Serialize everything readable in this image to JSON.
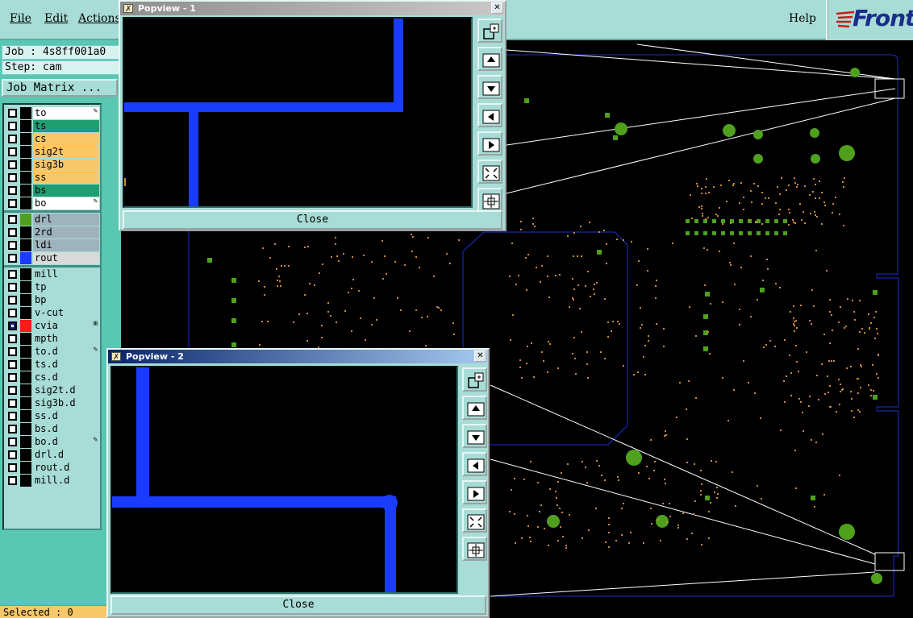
{
  "menubar": {
    "file": "File",
    "edit": "Edit",
    "actions": "Actions",
    "help": "Help",
    "logo": "Front"
  },
  "job": {
    "job_line": "Job : 4s8ff001a0",
    "step_line": "Step: cam",
    "matrix_button": "Job Matrix ..."
  },
  "layers": [
    {
      "name": "to",
      "bg": "#ffffff",
      "swatch": "#000000",
      "mark": "✎",
      "checked": false
    },
    {
      "name": "ts",
      "bg": "#1f9e72",
      "swatch": "#000000",
      "mark": "",
      "checked": false
    },
    {
      "name": "cs",
      "bg": "#f7c86a",
      "swatch": "#000000",
      "mark": "",
      "checked": false
    },
    {
      "name": "sig2t",
      "bg": "#f7c86a",
      "swatch": "#000000",
      "mark": "",
      "checked": false
    },
    {
      "name": "sig3b",
      "bg": "#f7c86a",
      "swatch": "#000000",
      "mark": "",
      "checked": false
    },
    {
      "name": "ss",
      "bg": "#f7c86a",
      "swatch": "#000000",
      "mark": "",
      "checked": false
    },
    {
      "name": "bs",
      "bg": "#1f9e72",
      "swatch": "#000000",
      "mark": "",
      "checked": false
    },
    {
      "name": "bo",
      "bg": "#ffffff",
      "swatch": "#000000",
      "mark": "✎",
      "checked": false
    },
    {
      "name": "drl",
      "bg": "#9fb3bd",
      "swatch": "#4fa11d",
      "mark": "",
      "checked": false
    },
    {
      "name": "2rd",
      "bg": "#9fb3bd",
      "swatch": "#000000",
      "mark": "",
      "checked": false
    },
    {
      "name": "ldi",
      "bg": "#9fb3bd",
      "swatch": "#000000",
      "mark": "",
      "checked": false
    },
    {
      "name": "rout",
      "bg": "#d9d9d9",
      "swatch": "#1a3cff",
      "mark": "",
      "checked": false
    },
    {
      "name": "mill",
      "bg": "#a8dcd6",
      "swatch": "#000000",
      "mark": "",
      "checked": false
    },
    {
      "name": "tp",
      "bg": "#a8dcd6",
      "swatch": "#000000",
      "mark": "",
      "checked": false
    },
    {
      "name": "bp",
      "bg": "#a8dcd6",
      "swatch": "#000000",
      "mark": "",
      "checked": false
    },
    {
      "name": "v-cut",
      "bg": "#a8dcd6",
      "swatch": "#000000",
      "mark": "",
      "checked": false
    },
    {
      "name": "cvia",
      "bg": "#a8dcd6",
      "swatch": "#ff1a1a",
      "mark": "⊞",
      "checked": true
    },
    {
      "name": "mpth",
      "bg": "#a8dcd6",
      "swatch": "#000000",
      "mark": "",
      "checked": false
    },
    {
      "name": "to.d",
      "bg": "#a8dcd6",
      "swatch": "#000000",
      "mark": "✎",
      "checked": false
    },
    {
      "name": "ts.d",
      "bg": "#a8dcd6",
      "swatch": "#000000",
      "mark": "",
      "checked": false
    },
    {
      "name": "cs.d",
      "bg": "#a8dcd6",
      "swatch": "#000000",
      "mark": "",
      "checked": false
    },
    {
      "name": "sig2t.d",
      "bg": "#a8dcd6",
      "swatch": "#000000",
      "mark": "",
      "checked": false
    },
    {
      "name": "sig3b.d",
      "bg": "#a8dcd6",
      "swatch": "#000000",
      "mark": "",
      "checked": false
    },
    {
      "name": "ss.d",
      "bg": "#a8dcd6",
      "swatch": "#000000",
      "mark": "",
      "checked": false
    },
    {
      "name": "bs.d",
      "bg": "#a8dcd6",
      "swatch": "#000000",
      "mark": "",
      "checked": false
    },
    {
      "name": "bo.d",
      "bg": "#a8dcd6",
      "swatch": "#000000",
      "mark": "✎",
      "checked": false
    },
    {
      "name": "drl.d",
      "bg": "#a8dcd6",
      "swatch": "#000000",
      "mark": "",
      "checked": false
    },
    {
      "name": "rout.d",
      "bg": "#a8dcd6",
      "swatch": "#000000",
      "mark": "",
      "checked": false
    },
    {
      "name": "mill.d",
      "bg": "#a8dcd6",
      "swatch": "#000000",
      "mark": "",
      "checked": false
    }
  ],
  "status": {
    "selected": "Selected : 0"
  },
  "popup1": {
    "title": "Popview - 1",
    "close_label": "Close",
    "close_x": "✕"
  },
  "popup2": {
    "title": "Popview - 2",
    "close_label": "Close",
    "close_x": "✕"
  },
  "tool_icons": [
    "zoom-window-icon",
    "pan-up-icon",
    "pan-down-icon",
    "pan-left-icon",
    "pan-right-icon",
    "zoom-fit-icon",
    "zoom-center-icon"
  ],
  "colors": {
    "panel": "#a8dcd6",
    "panel_dark": "#5ac7b2",
    "rout_trace": "#1a3cff",
    "pad_green": "#4fa11d",
    "drill_dots": "#c98a3a",
    "outline": "#1a2fd0"
  }
}
